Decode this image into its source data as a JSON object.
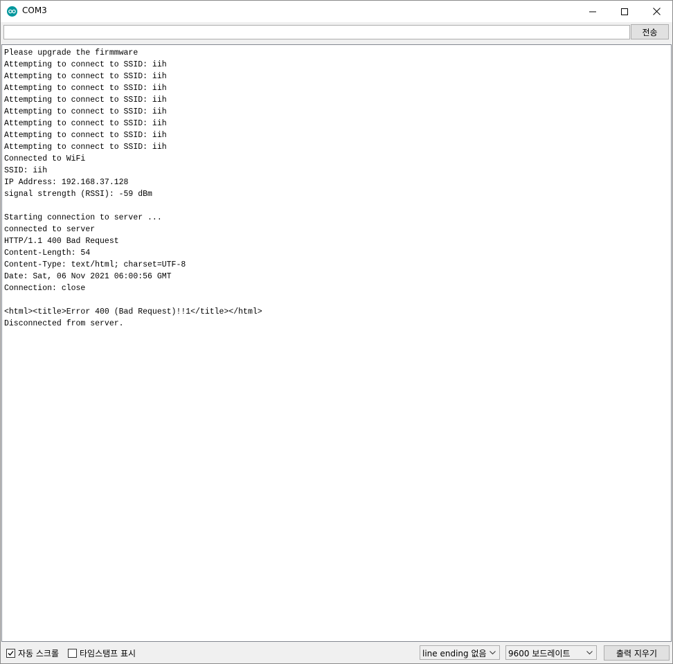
{
  "window": {
    "title": "COM3",
    "icon": "arduino-icon"
  },
  "send": {
    "input_value": "",
    "button_label": "전송"
  },
  "output": {
    "lines": [
      "Please upgrade the firmmware",
      "Attempting to connect to SSID: iih",
      "Attempting to connect to SSID: iih",
      "Attempting to connect to SSID: iih",
      "Attempting to connect to SSID: iih",
      "Attempting to connect to SSID: iih",
      "Attempting to connect to SSID: iih",
      "Attempting to connect to SSID: iih",
      "Attempting to connect to SSID: iih",
      "Connected to WiFi",
      "SSID: iih",
      "IP Address: 192.168.37.128",
      "signal strength (RSSI): -59 dBm",
      "",
      "Starting connection to server ...",
      "connected to server",
      "HTTP/1.1 400 Bad Request",
      "Content-Length: 54",
      "Content-Type: text/html; charset=UTF-8",
      "Date: Sat, 06 Nov 2021 06:00:56 GMT",
      "Connection: close",
      "",
      "<html><title>Error 400 (Bad Request)!!1</title></html>",
      "Disconnected from server."
    ]
  },
  "status": {
    "autoscroll_label": "자동 스크롤",
    "autoscroll_checked": true,
    "timestamp_label": "타임스탬프 표시",
    "timestamp_checked": false,
    "line_ending": "line ending 없음",
    "baud_rate": "9600 보드레이트",
    "clear_label": "출력 지우기"
  }
}
